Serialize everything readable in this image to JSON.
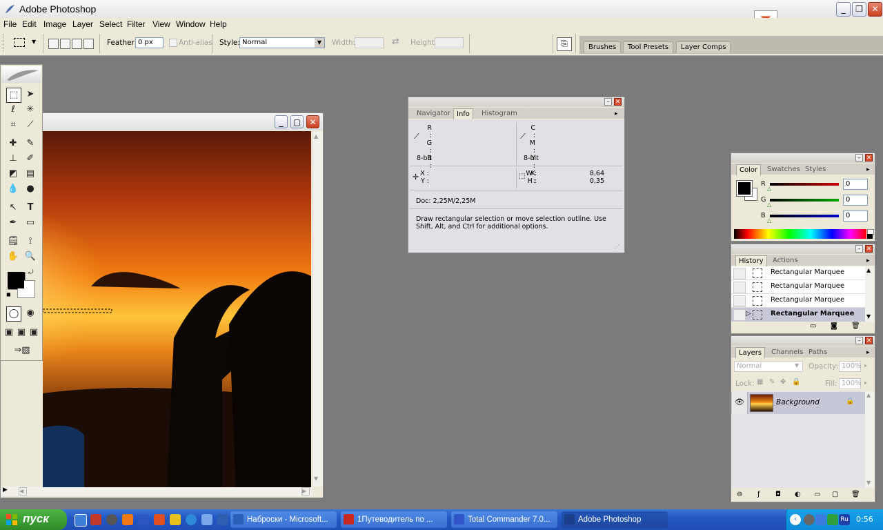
{
  "app": {
    "title": "Adobe Photoshop"
  },
  "menu": [
    "File",
    "Edit",
    "Image",
    "Layer",
    "Select",
    "Filter",
    "View",
    "Window",
    "Help"
  ],
  "options": {
    "feather_label": "Feather:",
    "feather_value": "0 px",
    "antialias_label": "Anti-alias",
    "style_label": "Style:",
    "style_value": "Normal",
    "width_label": "Width:",
    "height_label": "Height:"
  },
  "palette_well": {
    "tabs": [
      "Brushes",
      "Tool Presets",
      "Layer Comps"
    ]
  },
  "info_panel": {
    "tabs": [
      "Navigator",
      "Info",
      "Histogram"
    ],
    "active_tab": "Info",
    "rgb_labels": [
      "R :",
      "G :",
      "B :"
    ],
    "cmyk_labels": [
      "C :",
      "M :",
      "Y :",
      "K :"
    ],
    "bit_left": "8-bit",
    "bit_right": "8-bit",
    "xy_labels": [
      "X :",
      "Y :"
    ],
    "wh_labels": [
      "W :",
      "H :"
    ],
    "w_value": "8,64",
    "h_value": "0,35",
    "doc": "Doc: 2,25M/2,25M",
    "hint": "Draw rectangular selection or move selection outline.  Use Shift, Alt, and Ctrl for additional options."
  },
  "color_panel": {
    "tabs": [
      "Color",
      "Swatches",
      "Styles"
    ],
    "channels": [
      {
        "label": "R",
        "value": "0",
        "color": "#cc0000"
      },
      {
        "label": "G",
        "value": "0",
        "color": "#00aa00"
      },
      {
        "label": "B",
        "value": "0",
        "color": "#0000cc"
      }
    ]
  },
  "history_panel": {
    "tabs": [
      "History",
      "Actions"
    ],
    "items": [
      {
        "label": "Rectangular Marquee",
        "active": false
      },
      {
        "label": "Rectangular Marquee",
        "active": false
      },
      {
        "label": "Rectangular Marquee",
        "active": false
      },
      {
        "label": "Rectangular Marquee",
        "active": true
      }
    ]
  },
  "layers_panel": {
    "tabs": [
      "Layers",
      "Channels",
      "Paths"
    ],
    "blend_mode": "Normal",
    "opacity_label": "Opacity:",
    "opacity_value": "100%",
    "lock_label": "Lock:",
    "fill_label": "Fill:",
    "fill_value": "100%",
    "layer_name": "Background"
  },
  "taskbar": {
    "start_label": "пуск",
    "items": [
      {
        "label": "Наброски - Microsoft...",
        "icon_color": "#2b5fb8",
        "active": false
      },
      {
        "label": "1Путеводитель по ...",
        "icon_color": "#c8281e",
        "active": false
      },
      {
        "label": "Total Commander 7.0...",
        "icon_color": "#2f55c8",
        "active": false
      },
      {
        "label": "Adobe Photoshop",
        "icon_color": "#1c3f8c",
        "active": true
      }
    ],
    "lang": "Ru",
    "clock": "0:56"
  }
}
